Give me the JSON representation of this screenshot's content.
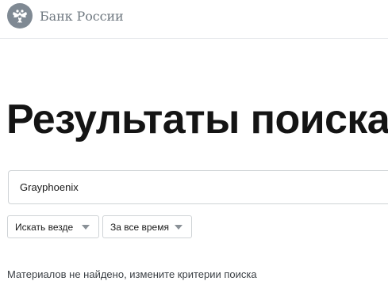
{
  "header": {
    "logo_text": "Банк России",
    "logo_icon": "double-headed-eagle-emblem"
  },
  "main": {
    "title": "Результаты поиска",
    "search": {
      "value": "Grayphoenix"
    },
    "filters": {
      "place": {
        "selected": "Искать везде"
      },
      "time": {
        "selected": "За все время"
      }
    },
    "message": "Материалов не найдено, измените критерии поиска"
  },
  "colors": {
    "emblem": "#7f8993",
    "text": "#141414",
    "border": "#cfd3d6"
  }
}
